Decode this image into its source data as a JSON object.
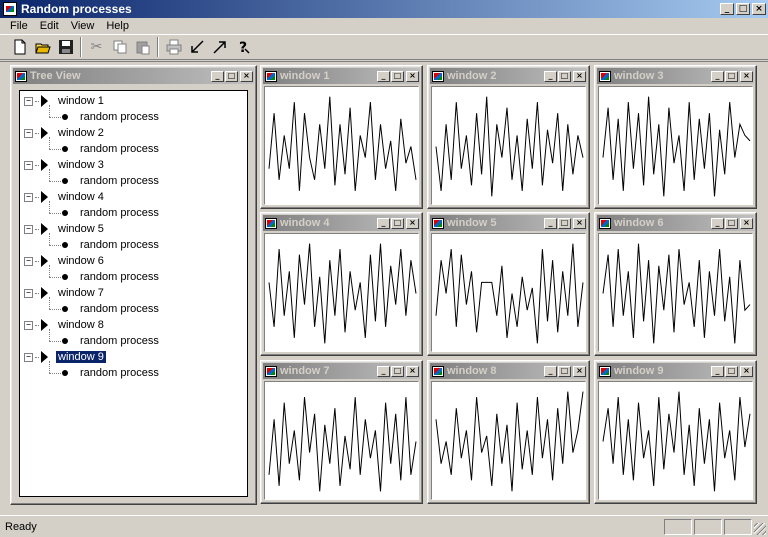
{
  "app": {
    "title": "Random processes",
    "icon": "app-chart-icon"
  },
  "menu": [
    {
      "label": "File"
    },
    {
      "label": "Edit"
    },
    {
      "label": "View"
    },
    {
      "label": "Help"
    }
  ],
  "toolbar": {
    "new_icon": "new-file-icon",
    "open_icon": "open-folder-icon",
    "save_icon": "save-disk-icon",
    "cut_icon": "cut-scissors-icon",
    "copy_icon": "copy-icon",
    "paste_icon": "paste-icon",
    "print_icon": "print-icon",
    "arrow_down_left_icon": "arrow-down-left-icon",
    "arrow_up_right_icon": "arrow-up-right-icon",
    "help_icon": "help-question-icon"
  },
  "tree_view": {
    "title": "Tree View",
    "child_label": "random process",
    "selected": "window 9",
    "items": [
      {
        "label": "window 1"
      },
      {
        "label": "window 2"
      },
      {
        "label": "window 3"
      },
      {
        "label": "window 4"
      },
      {
        "label": "window 5"
      },
      {
        "label": "window 6"
      },
      {
        "label": "window 7"
      },
      {
        "label": "window 8"
      },
      {
        "label": "window 9"
      }
    ]
  },
  "windows": [
    {
      "title": "window 1",
      "series": [
        0.3,
        0.8,
        0.2,
        0.6,
        0.3,
        0.9,
        0.1,
        0.8,
        0.4,
        0.2,
        0.7,
        0.3,
        0.95,
        0.15,
        0.7,
        0.25,
        0.85,
        0.1,
        0.6,
        0.4,
        0.9,
        0.2,
        0.7,
        0.3,
        0.55,
        0.1,
        0.75,
        0.35,
        0.5,
        0.2
      ]
    },
    {
      "title": "window 2",
      "series": [
        0.5,
        0.1,
        0.7,
        0.2,
        0.9,
        0.3,
        0.6,
        0.15,
        0.8,
        0.25,
        0.95,
        0.05,
        0.7,
        0.4,
        0.85,
        0.2,
        0.6,
        0.1,
        0.75,
        0.3,
        0.9,
        0.15,
        0.65,
        0.35,
        0.8,
        0.1,
        0.7,
        0.25,
        0.6,
        0.4
      ]
    },
    {
      "title": "window 3",
      "series": [
        0.4,
        0.85,
        0.2,
        0.75,
        0.1,
        0.9,
        0.3,
        0.8,
        0.15,
        0.95,
        0.25,
        0.7,
        0.05,
        0.85,
        0.35,
        0.6,
        0.1,
        0.9,
        0.2,
        0.75,
        0.3,
        0.8,
        0.05,
        0.65,
        0.25,
        0.9,
        0.4,
        0.7,
        0.6,
        0.55
      ]
    },
    {
      "title": "window 4",
      "series": [
        0.6,
        0.2,
        0.9,
        0.3,
        0.7,
        0.1,
        0.85,
        0.4,
        0.95,
        0.2,
        0.65,
        0.05,
        0.8,
        0.3,
        0.9,
        0.15,
        0.7,
        0.35,
        0.6,
        0.1,
        0.85,
        0.25,
        0.95,
        0.2,
        0.75,
        0.4,
        0.9,
        0.3,
        0.8,
        0.5
      ]
    },
    {
      "title": "window 5",
      "series": [
        0.3,
        0.8,
        0.5,
        0.9,
        0.2,
        0.85,
        0.4,
        0.7,
        0.15,
        0.6,
        0.6,
        0.6,
        0.3,
        0.75,
        0.1,
        0.5,
        0.2,
        0.65,
        0.35,
        0.55,
        0.05,
        0.9,
        0.25,
        0.8,
        0.15,
        0.7,
        0.3,
        0.95,
        0.2,
        0.6
      ]
    },
    {
      "title": "window 6",
      "series": [
        0.5,
        0.85,
        0.2,
        0.9,
        0.3,
        0.7,
        0.1,
        0.95,
        0.25,
        0.8,
        0.05,
        0.75,
        0.35,
        0.85,
        0.15,
        0.9,
        0.4,
        0.6,
        0.2,
        0.8,
        0.1,
        0.7,
        0.3,
        0.9,
        0.25,
        0.65,
        0.05,
        0.8,
        0.35,
        0.4
      ]
    },
    {
      "title": "window 7",
      "series": [
        0.2,
        0.7,
        0.1,
        0.85,
        0.3,
        0.6,
        0.15,
        0.9,
        0.4,
        0.75,
        0.05,
        0.65,
        0.3,
        0.8,
        0.1,
        0.55,
        0.25,
        0.9,
        0.2,
        0.7,
        0.35,
        0.6,
        0.05,
        0.85,
        0.3,
        0.75,
        0.15,
        0.9,
        0.2,
        0.5
      ]
    },
    {
      "title": "window 8",
      "series": [
        0.7,
        0.3,
        0.5,
        0.2,
        0.8,
        0.35,
        0.6,
        0.15,
        0.9,
        0.4,
        0.55,
        0.1,
        0.75,
        0.3,
        0.65,
        0.05,
        0.85,
        0.25,
        0.6,
        0.2,
        0.9,
        0.35,
        0.7,
        0.15,
        0.8,
        0.3,
        0.95,
        0.4,
        0.6,
        0.95
      ]
    },
    {
      "title": "window 9",
      "series": [
        0.5,
        0.8,
        0.3,
        0.9,
        0.2,
        0.7,
        0.15,
        0.85,
        0.35,
        0.6,
        0.1,
        0.9,
        0.25,
        0.75,
        0.4,
        0.95,
        0.2,
        0.65,
        0.1,
        0.8,
        0.3,
        0.7,
        0.05,
        0.85,
        0.35,
        0.6,
        0.15,
        0.9,
        0.45,
        0.75
      ]
    }
  ],
  "status": {
    "text": "Ready"
  }
}
